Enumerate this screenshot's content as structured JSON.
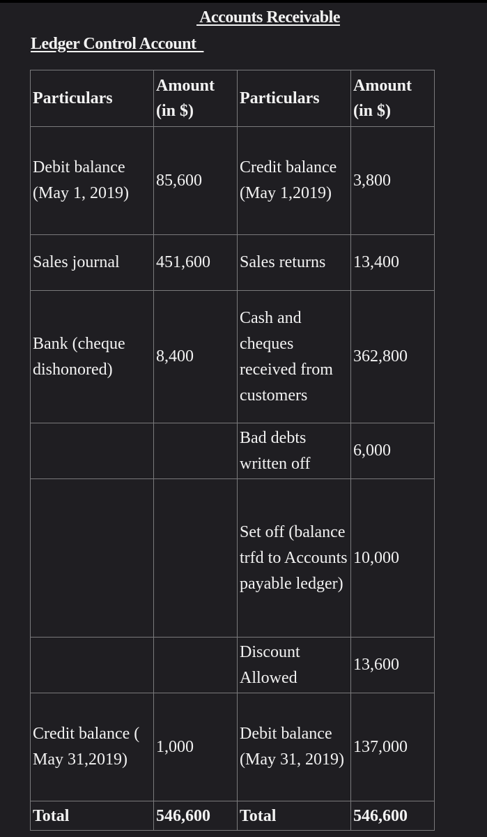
{
  "header": {
    "title_line1": " Accounts Receivable",
    "title_line2": "Ledger Control Account  "
  },
  "table": {
    "columns": [
      "Particulars",
      "Amount (in $)",
      "Particulars",
      "Amount (in $)"
    ],
    "rows": [
      {
        "debit_particulars": "Debit balance (May 1, 2019)",
        "debit_amount": "85,600",
        "credit_particulars": "Credit balance (May 1,2019)",
        "credit_amount": "3,800"
      },
      {
        "debit_particulars": "Sales journal",
        "debit_amount": "451,600",
        "credit_particulars": "Sales returns",
        "credit_amount": "13,400"
      },
      {
        "debit_particulars": "Bank (cheque dishonored)",
        "debit_amount": "8,400",
        "credit_particulars": "Cash and cheques received from customers",
        "credit_amount": "362,800"
      },
      {
        "debit_particulars": "",
        "debit_amount": "",
        "credit_particulars": "Bad debts written off",
        "credit_amount": "6,000"
      },
      {
        "debit_particulars": "",
        "debit_amount": "",
        "credit_particulars": "Set off (balance trfd to Accounts payable ledger)",
        "credit_amount": "10,000"
      },
      {
        "debit_particulars": "",
        "debit_amount": "",
        "credit_particulars": "Discount Allowed",
        "credit_amount": "13,600"
      },
      {
        "debit_particulars": "Credit balance ( May 31,2019)",
        "debit_amount": "1,000",
        "credit_particulars": "Debit balance (May 31, 2019)",
        "credit_amount": "137,000"
      }
    ],
    "total": {
      "debit_label": "Total",
      "debit_amount": "546,600",
      "credit_label": "Total",
      "credit_amount": "546,600"
    }
  }
}
